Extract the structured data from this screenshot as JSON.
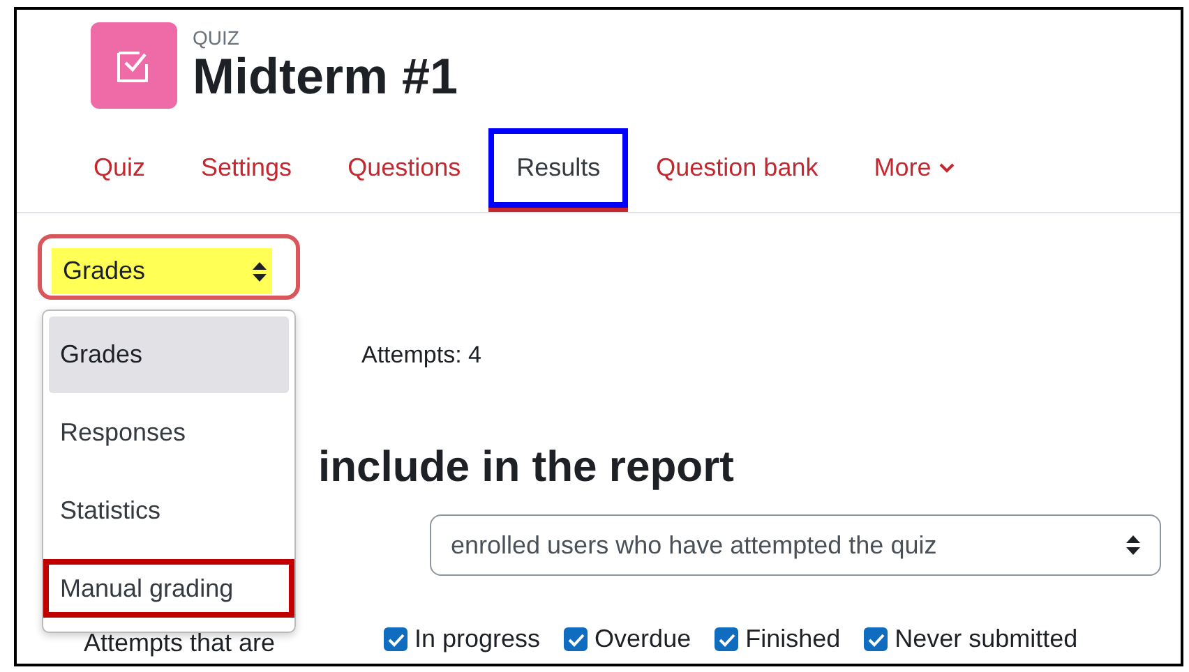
{
  "header": {
    "kicker": "QUIZ",
    "title": "Midterm #1"
  },
  "tabs": [
    {
      "label": "Quiz",
      "kind": "link",
      "selected": false,
      "highlighted": false
    },
    {
      "label": "Settings",
      "kind": "link",
      "selected": false,
      "highlighted": false
    },
    {
      "label": "Questions",
      "kind": "link",
      "selected": false,
      "highlighted": false
    },
    {
      "label": "Results",
      "kind": "link",
      "selected": true,
      "highlighted": true
    },
    {
      "label": "Question bank",
      "kind": "link",
      "selected": false,
      "highlighted": false
    },
    {
      "label": "More",
      "kind": "menu",
      "selected": false,
      "highlighted": false
    }
  ],
  "report_select": {
    "value": "Grades",
    "highlighted": true,
    "expanded": true,
    "options": [
      {
        "label": "Grades",
        "selected": true,
        "highlighted": false
      },
      {
        "label": "Responses",
        "selected": false,
        "highlighted": false
      },
      {
        "label": "Statistics",
        "selected": false,
        "highlighted": false
      },
      {
        "label": "Manual grading",
        "selected": false,
        "highlighted": true
      }
    ]
  },
  "attempts": "Attempts: 4",
  "section_heading": "include in the report",
  "attempts_from": {
    "value": "enrolled users who have attempted the quiz"
  },
  "attempt_states": {
    "label": "Attempts that are",
    "options": [
      {
        "label": "In progress",
        "checked": true
      },
      {
        "label": "Overdue",
        "checked": true
      },
      {
        "label": "Finished",
        "checked": true
      },
      {
        "label": "Never submitted",
        "checked": true
      }
    ]
  }
}
